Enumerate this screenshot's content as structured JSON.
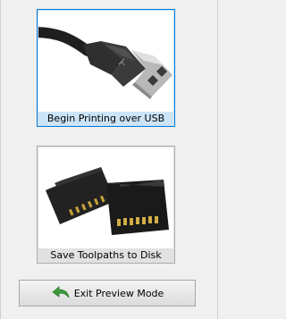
{
  "options": {
    "usb_label": "Begin Printing over USB",
    "sd_label": "Save Toolpaths to Disk"
  },
  "footer": {
    "exit_label": "Exit Preview Mode"
  },
  "icons": {
    "usb": "usb-cable-icon",
    "sd": "sd-cards-icon",
    "exit": "back-arrow-icon"
  },
  "colors": {
    "selected_border": "#0078d7",
    "selected_fill": "#cce4f7",
    "arrow_green": "#3c9a3c"
  }
}
